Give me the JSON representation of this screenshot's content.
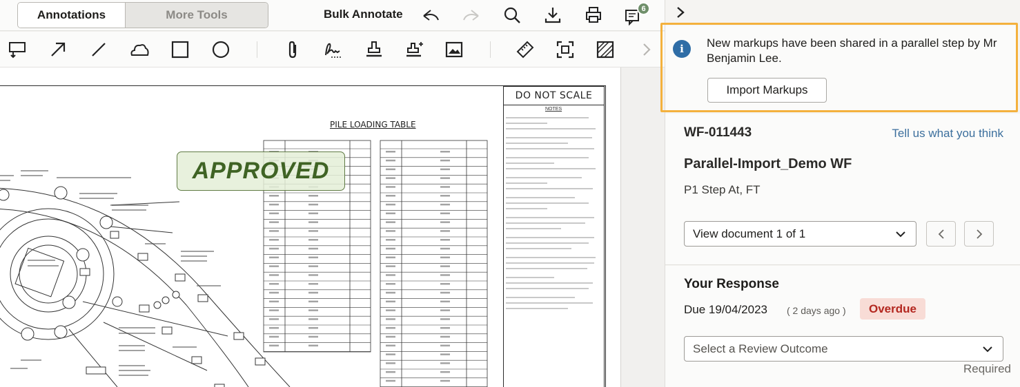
{
  "toolbar": {
    "tab_annotations": "Annotations",
    "tab_more_tools": "More Tools",
    "bulk_annotate": "Bulk Annotate",
    "markup_count": "6",
    "icons": [
      "undo-icon",
      "redo-icon",
      "search-icon",
      "download-icon",
      "print-icon",
      "markups-icon"
    ]
  },
  "tools": [
    "callout-icon",
    "arrow-icon",
    "line-icon",
    "cloud-icon",
    "rectangle-icon",
    "ellipse-icon",
    "attachment-icon",
    "signature-icon",
    "stamp-icon",
    "custom-stamp-icon",
    "image-icon",
    "measure-icon",
    "area-select-icon",
    "hatch-icon",
    "chevron-right-icon"
  ],
  "document": {
    "do_not_scale": "DO NOT SCALE",
    "notes_title": "NOTES",
    "table_title": "PILE LOADING TABLE",
    "stamp": "APPROVED"
  },
  "panel": {
    "notice_text": "New markups have been shared in a parallel step by Mr Benjamin Lee.",
    "import_button": "Import Markups",
    "workflow_id": "WF-011443",
    "feedback_link": "Tell us what you think",
    "workflow_name": "Parallel-Import_Demo WF",
    "step_name": "P1 Step At, FT",
    "document_select": "View document 1 of 1",
    "response_title": "Your Response",
    "due_date": "Due 19/04/2023",
    "due_relative": "( 2 days ago )",
    "status_badge": "Overdue",
    "outcome_placeholder": "Select a Review Outcome",
    "required_label": "Required"
  },
  "colors": {
    "highlight": "#f4b13d",
    "info": "#2f6da6",
    "stamp_green": "#3f6324",
    "overdue_bg": "#f8dcd6",
    "overdue_text": "#b3271f",
    "link": "#3c6f9d"
  }
}
